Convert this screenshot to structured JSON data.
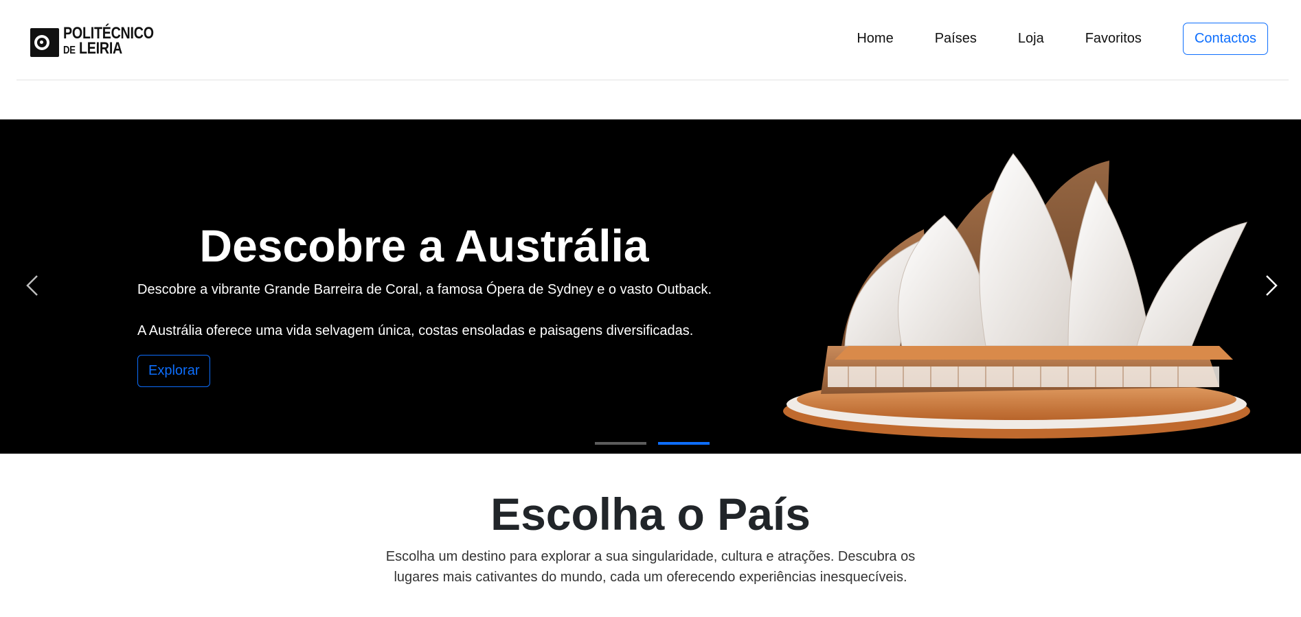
{
  "header": {
    "logo_line1": "POLITÉCNICO",
    "logo_de": "DE",
    "logo_line2": "LEIRIA",
    "nav": [
      "Home",
      "Países",
      "Loja",
      "Favoritos"
    ],
    "contact_label": "Contactos"
  },
  "hero": {
    "title": "Descobre a Austrália",
    "text1": "Descobre a vibrante Grande Barreira de Coral, a famosa Ópera de Sydney e o vasto Outback.",
    "text2": "A Austrália oferece uma vida selvagem única, costas ensoladas e paisagens diversificadas.",
    "button": "Explorar",
    "indicators": 2,
    "active_indicator": 2,
    "image": "sydney-opera-house-model"
  },
  "section": {
    "title": "Escolha o País",
    "text": "Escolha um destino para explorar a sua singularidade, cultura e atrações. Descubra os lugares mais cativantes do mundo, cada um oferecendo experiências inesquecíveis."
  },
  "colors": {
    "accent": "#0d6efd",
    "hero_bg": "#000000",
    "text": "#212529"
  }
}
